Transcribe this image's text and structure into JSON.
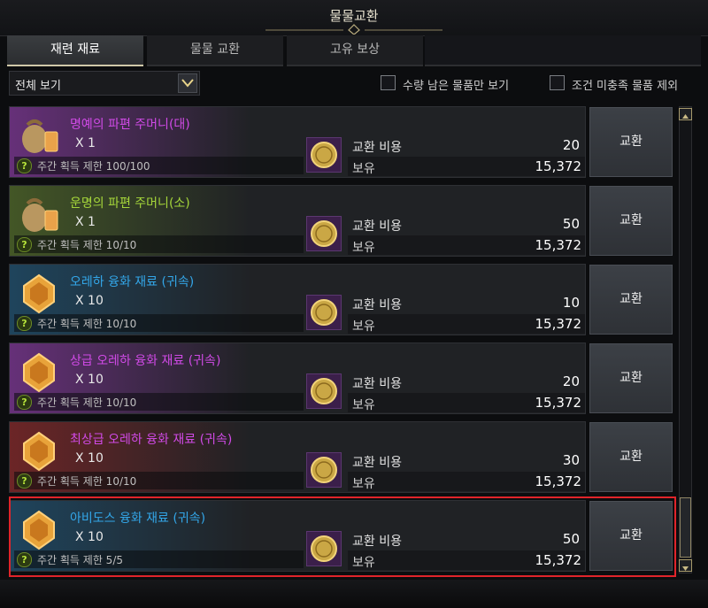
{
  "window": {
    "title": "물물교환"
  },
  "tabs": [
    {
      "label": "재련 재료",
      "active": true
    },
    {
      "label": "물물 교환",
      "active": false
    },
    {
      "label": "고유 보상",
      "active": false
    }
  ],
  "filter": {
    "selected": "전체 보기",
    "check_remaining_label": "수량 남은 물품만 보기",
    "check_unmet_label": "조건 미충족 물품 제외"
  },
  "colors": {
    "accent_gold": "#cfc7a8",
    "highlight_red": "#e0242a",
    "name_purple": "#d04ae6",
    "name_green": "#a5d63a",
    "name_blue": "#33a6e8"
  },
  "items": [
    {
      "name": "명예의 파편 주머니(대)",
      "name_color": "#d04ae6",
      "tint": "purple",
      "icon": "pouch-icon",
      "qty": "X 1",
      "limit": "주간 획득 제한 100/100",
      "cost_label": "교환 비용",
      "cost": "20",
      "own_label": "보유",
      "own": "15,372",
      "button": "교환"
    },
    {
      "name": "운명의 파편 주머니(소)",
      "name_color": "#a5d63a",
      "tint": "green",
      "icon": "pouch-icon",
      "qty": "X 1",
      "limit": "주간 획득 제한 10/10",
      "cost_label": "교환 비용",
      "cost": "50",
      "own_label": "보유",
      "own": "15,372",
      "button": "교환"
    },
    {
      "name": "오레하 융화 재료 (귀속)",
      "name_color": "#33a6e8",
      "tint": "blue",
      "icon": "ore-icon",
      "qty": "X 10",
      "limit": "주간 획득 제한 10/10",
      "cost_label": "교환 비용",
      "cost": "10",
      "own_label": "보유",
      "own": "15,372",
      "button": "교환"
    },
    {
      "name": "상급 오레하 융화 재료 (귀속)",
      "name_color": "#d04ae6",
      "tint": "purple",
      "icon": "ore-icon",
      "qty": "X 10",
      "limit": "주간 획득 제한 10/10",
      "cost_label": "교환 비용",
      "cost": "20",
      "own_label": "보유",
      "own": "15,372",
      "button": "교환"
    },
    {
      "name": "최상급 오레하 융화 재료 (귀속)",
      "name_color": "#d04ae6",
      "tint": "red",
      "icon": "ore-icon",
      "qty": "X 10",
      "limit": "주간 획득 제한 10/10",
      "cost_label": "교환 비용",
      "cost": "30",
      "own_label": "보유",
      "own": "15,372",
      "button": "교환"
    },
    {
      "name": "아비도스 융화 재료 (귀속)",
      "name_color": "#33a6e8",
      "tint": "blue",
      "icon": "ore-icon",
      "qty": "X 10",
      "limit": "주간 획득 제한 5/5",
      "cost_label": "교환 비용",
      "cost": "50",
      "own_label": "보유",
      "own": "15,372",
      "button": "교환"
    }
  ]
}
